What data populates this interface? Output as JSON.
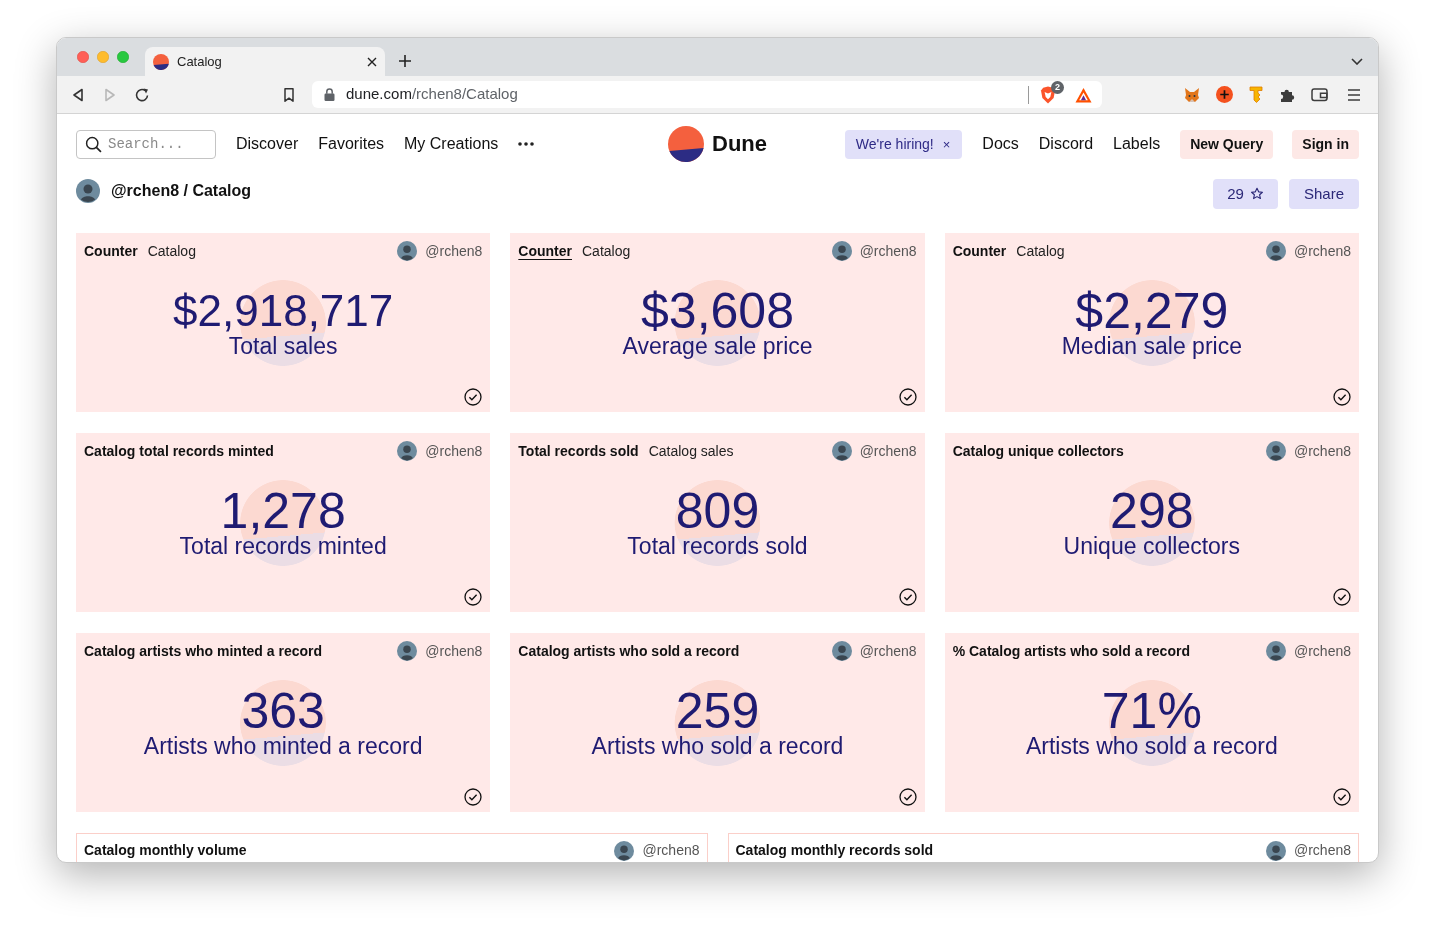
{
  "browser": {
    "tab": {
      "title": "Catalog",
      "selected": true
    },
    "url": {
      "host": "dune.com",
      "path": "/rchen8/Catalog"
    },
    "shields_count": "2"
  },
  "nav": {
    "search": {
      "placeholder": "Search..."
    },
    "links": [
      "Discover",
      "Favorites",
      "My Creations"
    ],
    "brand": "Dune",
    "hiring": {
      "label": "We're hiring!",
      "dismiss": "×"
    },
    "right_links": [
      "Docs",
      "Discord",
      "Labels"
    ],
    "buttons": [
      "New Query",
      "Sign in"
    ]
  },
  "dashboard": {
    "title": "@rchen8 / Catalog",
    "star_count": "29",
    "share": "Share"
  },
  "counters": [
    {
      "visualization": "Counter",
      "query": "Catalog",
      "hovered": false,
      "owner": "@rchen8",
      "value": "$2,918,717",
      "label": "Total sales"
    },
    {
      "visualization": "Counter",
      "query": "Catalog",
      "hovered": true,
      "owner": "@rchen8",
      "value": "$3,608",
      "label": "Average sale price"
    },
    {
      "visualization": "Counter",
      "query": "Catalog",
      "hovered": false,
      "owner": "@rchen8",
      "value": "$2,279",
      "label": "Median sale price"
    },
    {
      "visualization": "Catalog total records minted",
      "hovered": false,
      "owner": "@rchen8",
      "value": "1,278",
      "label": "Total records minted"
    },
    {
      "visualization": "Total records sold",
      "query": "Catalog sales",
      "hovered": false,
      "owner": "@rchen8",
      "value": "809",
      "label": "Total records sold"
    },
    {
      "visualization": "Catalog unique collectors",
      "hovered": false,
      "owner": "@rchen8",
      "value": "298",
      "label": "Unique collectors"
    },
    {
      "visualization": "Catalog artists who minted a record",
      "hovered": false,
      "owner": "@rchen8",
      "value": "363",
      "label": "Artists who minted a record"
    },
    {
      "visualization": "Catalog artists who sold a record",
      "hovered": false,
      "owner": "@rchen8",
      "value": "259",
      "label": "Artists who sold a record"
    },
    {
      "visualization": "% Catalog artists who sold a record",
      "hovered": false,
      "owner": "@rchen8",
      "value": "71%",
      "label": "Artists who sold a record"
    }
  ],
  "charts": [
    {
      "title": "Catalog monthly volume",
      "owner": "@rchen8"
    },
    {
      "title": "Catalog monthly records sold",
      "owner": "@rchen8"
    }
  ]
}
